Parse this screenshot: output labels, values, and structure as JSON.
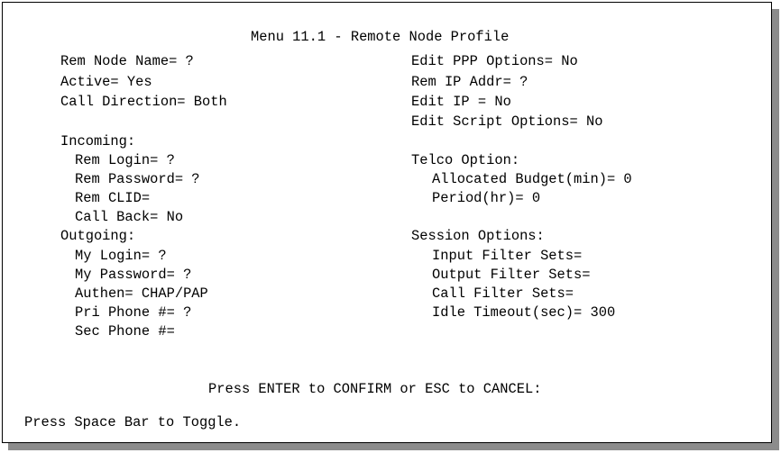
{
  "title": "Menu 11.1 - Remote Node Profile",
  "fields": {
    "rem_node_name": "Rem Node Name= ?",
    "active": "Active= Yes",
    "call_direction": "Call Direction= Both",
    "incoming_heading": "Incoming:",
    "rem_login": "Rem Login= ?",
    "rem_password": "Rem Password= ?",
    "rem_clid": "Rem CLID=",
    "call_back": "Call Back= No",
    "outgoing_heading": "Outgoing:",
    "my_login": "My Login= ?",
    "my_password": "My Password= ?",
    "authen": "Authen= CHAP/PAP",
    "pri_phone": "Pri Phone #= ?",
    "sec_phone": "Sec Phone #=",
    "edit_ppp_options": "Edit PPP Options= No",
    "rem_ip_addr": "Rem IP Addr= ?",
    "edit_ip": "Edit IP = No",
    "edit_script_options": "Edit Script Options= No",
    "telco_heading": "Telco Option:",
    "allocated_budget": "Allocated Budget(min)= 0",
    "period": "Period(hr)= 0",
    "session_heading": "Session Options:",
    "input_filter_sets": "Input Filter Sets=",
    "output_filter_sets": "Output Filter Sets=",
    "call_filter_sets": "Call Filter Sets=",
    "idle_timeout": "Idle Timeout(sec)= 300"
  },
  "prompt": "Press ENTER to CONFIRM or ESC to CANCEL:",
  "status_line": "Press Space Bar to Toggle."
}
